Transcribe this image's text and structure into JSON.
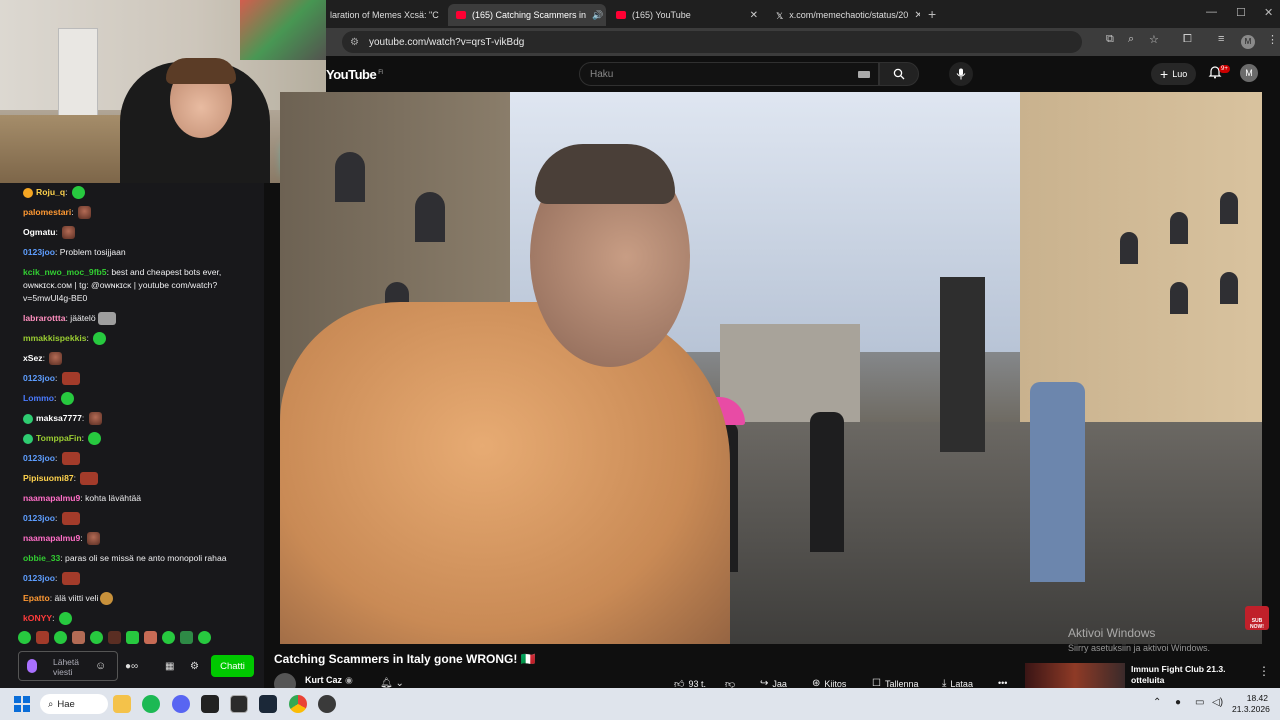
{
  "browser": {
    "tabs": [
      {
        "title": "laration of Memes Xcsä: \"C",
        "active": false,
        "icon_color": "#1f1f1f"
      },
      {
        "title": "(165) Catching Scammers in",
        "active": true,
        "icon_color": "#ff0033"
      },
      {
        "title": "(165) YouTube",
        "active": false,
        "icon_color": "#ff0033"
      },
      {
        "title": "x.com/memechaotic/status/20",
        "active": false,
        "icon_color": "#ffffff"
      }
    ],
    "new_tab": "+",
    "url": "youtube.com/watch?v=qrsT-vikBdg",
    "profile_initial": "M"
  },
  "youtube": {
    "logo": "YouTube",
    "logo_region": "FI",
    "search_placeholder": "Haku",
    "create_label": "Luo",
    "notif_count": "9+",
    "avatar_initial": "M",
    "video_title": "Catching Scammers in Italy gone WRONG! ",
    "video_title_emoji": "🇮🇹",
    "channel": "Kurt Caz",
    "actions": {
      "likes": "93 t.",
      "share": "Jaa",
      "thanks": "Kiitos",
      "save": "Tallenna",
      "download": "Lataa",
      "more": "•••"
    },
    "recommendation": {
      "title_line1": "Immun Fight Club 21.3.",
      "title_line2": "otteluita"
    },
    "sub_now": "SUB NOW!"
  },
  "windows_activation": {
    "line1": "Aktivoi Windows",
    "line2": "Siirry asetuksiin ja aktivoi Windows."
  },
  "chat": {
    "messages": [
      {
        "user": "Roju_q",
        "color": "#ffd34d",
        "text": "",
        "emotes": [
          "green"
        ],
        "badge": "#f5a623"
      },
      {
        "user": "palomestari",
        "color": "#ff9933",
        "text": "",
        "emotes": [
          "face"
        ]
      },
      {
        "user": "Ogmatu",
        "color": "#ffffff",
        "text": "",
        "emotes": [
          "face"
        ]
      },
      {
        "user": "0123joo",
        "color": "#5e9eff",
        "text": "Problem tosijjaan",
        "emotes": []
      },
      {
        "user": "kcik_nwo_moc_9fb5",
        "color": "#32cd32",
        "text": "best and cheapest bots ever, ᴏᴡɴᴋɪᴄᴋ.ᴄᴏᴍ | tg: @ᴏᴡɴᴋɪᴄᴋ | youtube com/watch?v=5mwUl4g-BE0",
        "emotes": []
      },
      {
        "user": "labrarottta",
        "color": "#ff8fbf",
        "text": "jäätelö",
        "emotes": [
          "cat"
        ]
      },
      {
        "user": "mmakkispekkis",
        "color": "#9acd32",
        "text": "",
        "emotes": [
          "green"
        ]
      },
      {
        "user": "xSez",
        "color": "#ffffff",
        "text": "",
        "emotes": [
          "face"
        ]
      },
      {
        "user": "0123joo",
        "color": "#5e9eff",
        "text": "",
        "emotes": [
          "red"
        ]
      },
      {
        "user": "Lommo",
        "color": "#4a7bff",
        "text": "",
        "emotes": [
          "green"
        ]
      },
      {
        "user": "maksa7777",
        "color": "#ffffff",
        "text": "",
        "emotes": [
          "face"
        ],
        "badge": "#2ecc71"
      },
      {
        "user": "TomppaFin",
        "color": "#9acd32",
        "text": "",
        "emotes": [
          "green"
        ],
        "badge": "#2ecc71"
      },
      {
        "user": "0123joo",
        "color": "#5e9eff",
        "text": "",
        "emotes": [
          "red"
        ]
      },
      {
        "user": "Pipisuomi87",
        "color": "#ffd34d",
        "text": "",
        "emotes": [
          "red"
        ]
      },
      {
        "user": "naamapalmu9",
        "color": "#ff6ec7",
        "text": "kohta lävähtää",
        "emotes": []
      },
      {
        "user": "0123joo",
        "color": "#5e9eff",
        "text": "",
        "emotes": [
          "red"
        ]
      },
      {
        "user": "naamapalmu9",
        "color": "#ff6ec7",
        "text": "",
        "emotes": [
          "face"
        ]
      },
      {
        "user": "obbie_33",
        "color": "#32cd32",
        "text": "paras oli se missä ne anto monopoli rahaa",
        "emotes": []
      },
      {
        "user": "0123joo",
        "color": "#5e9eff",
        "text": "",
        "emotes": [
          "red"
        ]
      },
      {
        "user": "Epatto",
        "color": "#ff9933",
        "text": "älä viitti veli",
        "emotes": [
          "cookie"
        ]
      },
      {
        "user": "kONYY",
        "color": "#ff3b3b",
        "text": "",
        "emotes": [
          "green"
        ]
      }
    ],
    "input_placeholder": "Lähetä viesti",
    "send_label": "Chatti"
  },
  "taskbar": {
    "search_label": "Hae",
    "time": "18.42",
    "date": "21.3.2026"
  }
}
